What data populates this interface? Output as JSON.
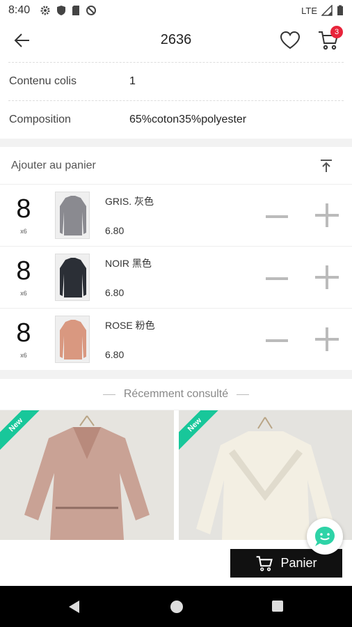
{
  "status_bar": {
    "time": "8:40",
    "network": "LTE"
  },
  "header": {
    "title": "2636",
    "cart_count": "3"
  },
  "details": [
    {
      "label": "Contenu colis",
      "value": "1"
    },
    {
      "label": "Composition",
      "value": "65%coton35%polyester"
    }
  ],
  "cart": {
    "title": "Ajouter au panier",
    "items": [
      {
        "qty": "8",
        "mult": "x6",
        "name": "GRIS. 灰色",
        "price": "6.80",
        "color": "#8a8a90"
      },
      {
        "qty": "8",
        "mult": "x6",
        "name": "NOIR 黑色",
        "price": "6.80",
        "color": "#2b2f36"
      },
      {
        "qty": "8",
        "mult": "x6",
        "name": "ROSE 粉色",
        "price": "6.80",
        "color": "#d99880"
      }
    ]
  },
  "recent": {
    "title": "Récemment consulté",
    "products": [
      {
        "badge": "New"
      },
      {
        "badge": "New"
      }
    ]
  },
  "panier_button": "Panier",
  "colors": {
    "accent": "#e8243b",
    "new_badge": "#18c79a",
    "chat": "#2ed3a7"
  }
}
